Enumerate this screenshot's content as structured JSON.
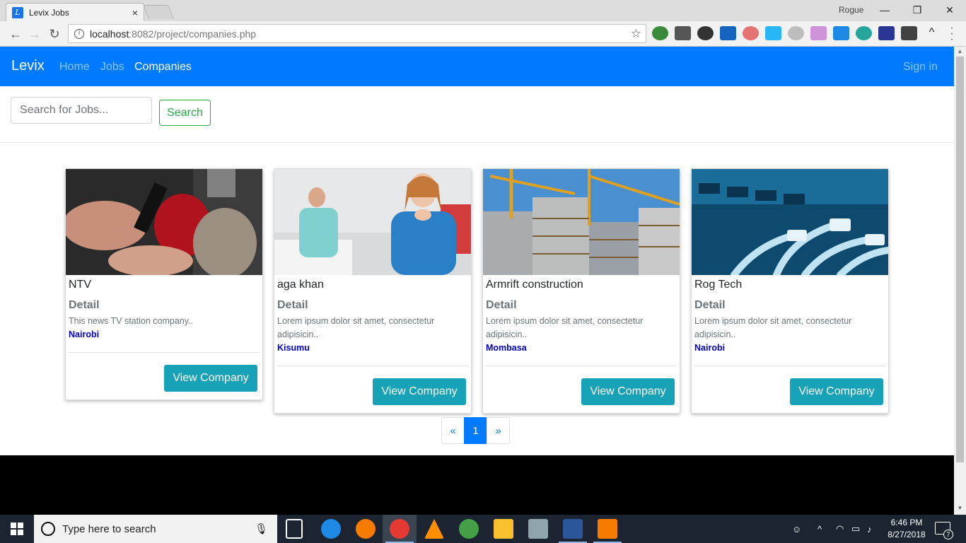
{
  "browser": {
    "tab_title": "Levix Jobs",
    "tab_close": "×",
    "profile": "Rogue",
    "url_host": "localhost",
    "url_path": ":8082/project/companies.php",
    "back": "←",
    "forward": "→",
    "reload": "↻",
    "star": "☆",
    "minimize": "—",
    "restore": "❐",
    "close": "✕"
  },
  "navbar": {
    "brand": "Levix",
    "links": [
      "Home",
      "Jobs",
      "Companies"
    ],
    "active_link": "Companies",
    "signin": "Sign in",
    "color": "#007bff"
  },
  "search": {
    "placeholder": "Search for Jobs...",
    "button": "Search"
  },
  "companies": [
    {
      "name": "NTV",
      "detail_label": "Detail",
      "description": "This news TV station company..",
      "location": "Nairobi",
      "button": "View Company",
      "image": "microphones-press-photo"
    },
    {
      "name": "aga khan",
      "detail_label": "Detail",
      "description": "Lorem ipsum dolor sit amet, consectetur adipisicin..",
      "location": "Kisumu",
      "button": "View Company",
      "image": "nurse-hospital-photo"
    },
    {
      "name": "Armrift construction",
      "detail_label": "Detail",
      "description": "Lorem ipsum dolor sit amet, consectetur adipisicin..",
      "location": "Mombasa",
      "button": "View Company",
      "image": "construction-crane-photo"
    },
    {
      "name": "Rog Tech",
      "detail_label": "Detail",
      "description": "Lorem ipsum dolor sit amet, consectetur adipisicin..",
      "location": "Nairobi",
      "button": "View Company",
      "image": "network-cables-photo"
    }
  ],
  "pagination": {
    "prev": "«",
    "pages": [
      "1"
    ],
    "current": "1",
    "next": "»"
  },
  "taskbar": {
    "search_placeholder": "Type here to search",
    "time": "6:46 PM",
    "date": "8/27/2018",
    "notifications": "7"
  }
}
